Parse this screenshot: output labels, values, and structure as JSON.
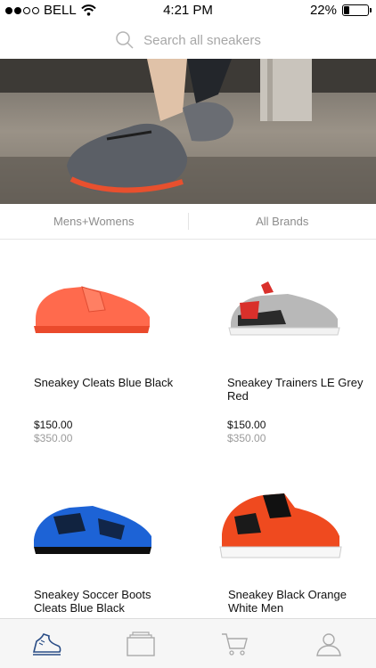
{
  "status_bar": {
    "carrier": "BELL",
    "time": "4:21 PM",
    "battery": "22%",
    "battery_level": 0.22,
    "signal_icon": "signal-dots-icon",
    "wifi_icon": "wifi-icon"
  },
  "search": {
    "placeholder": "Search all sneakers",
    "icon": "search-icon"
  },
  "filters": {
    "gender_label": "Mens+Womens",
    "brand_label": "All Brands"
  },
  "products": [
    {
      "name": "Sneakey  Cleats Blue Black",
      "price": "$150.00",
      "old_price": "$350.00",
      "color": "#ff6a4d"
    },
    {
      "name": "Sneakey  Trainers LE Grey Red",
      "price": "$150.00",
      "old_price": "$350.00",
      "color": "#b8b8b8"
    },
    {
      "name": "Sneakey  Soccer Boots Cleats Blue Black",
      "price": "",
      "old_price": "",
      "color": "#1d63d6"
    },
    {
      "name": "Sneakey  Black Orange White Men",
      "price": "",
      "old_price": "",
      "color": "#ef4a1f"
    }
  ],
  "tabbar": {
    "items": [
      {
        "icon": "sneaker-icon",
        "active": true
      },
      {
        "icon": "cards-icon",
        "active": false
      },
      {
        "icon": "cart-icon",
        "active": false
      },
      {
        "icon": "user-icon",
        "active": false
      }
    ],
    "accent": "#2a4d86"
  }
}
